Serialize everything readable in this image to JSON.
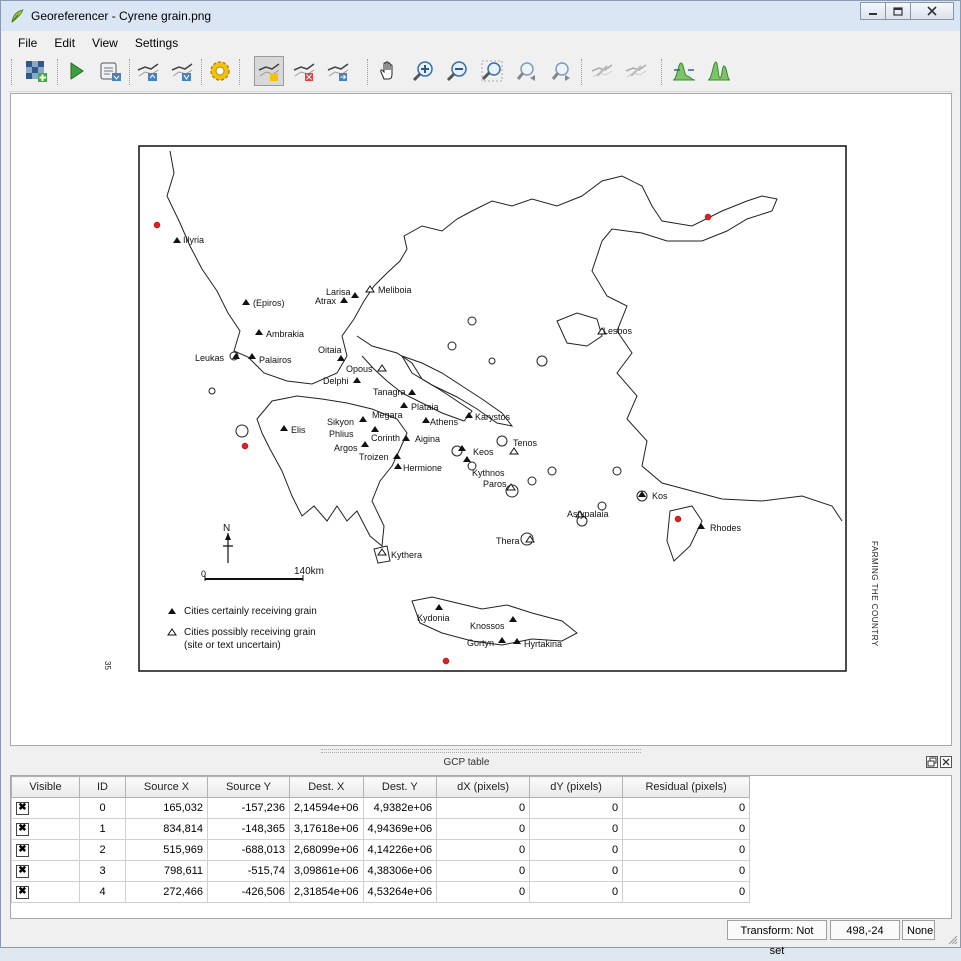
{
  "window": {
    "title": "Georeferencer - Cyrene grain.png",
    "controls": [
      "minimize",
      "maximize",
      "close"
    ]
  },
  "menu": [
    "File",
    "Edit",
    "View",
    "Settings"
  ],
  "toolbar": {
    "icons": [
      "open-raster-icon",
      "start-georeferencing-icon",
      "generate-gdal-script-icon",
      "load-gcp-points-icon",
      "save-gcp-points-icon",
      "transformation-settings-icon",
      "add-point-icon",
      "delete-point-icon",
      "move-gcp-point-icon",
      "pan-icon",
      "zoom-in-icon",
      "zoom-out-icon",
      "zoom-to-layer-icon",
      "zoom-last-icon",
      "zoom-next-icon",
      "link-georeferencer-to-qgis-icon",
      "link-qgis-to-georeferencer-icon",
      "full-histogram-stretch-icon",
      "local-histogram-stretch-icon"
    ]
  },
  "map": {
    "side_text": "FARMING THE COUNTRY",
    "page_number": "35",
    "scale_label": "140km",
    "scale_zero": "0",
    "north_label": "N",
    "legend": {
      "certain": "Cities certainly receiving grain",
      "possible_1": "Cities possibly receiving grain",
      "possible_2": "(site or text uncertain)"
    },
    "labels": {
      "illyria": "Illyria",
      "epiros": "(Epiros)",
      "ambrakia": "Ambrakia",
      "leukas": "Leukas",
      "palairos": "Palairos",
      "larisa": "Larisa",
      "atrax": "Atrax",
      "meliboia": "Meliboia",
      "oitaia": "Oitaia",
      "opous": "Opous",
      "delphi": "Delphi",
      "tanagra": "Tanagra",
      "plataia": "Plataia",
      "megara": "Megara",
      "athens": "Athens",
      "karystos": "Karystos",
      "sikyon": "Sikyon",
      "phlius": "Phlius",
      "corinth": "Corinth",
      "aigina": "Aigina",
      "argos": "Argos",
      "troizen": "Troizen",
      "hermione": "Hermione",
      "elis": "Elis",
      "keos": "Keos",
      "kythnos": "Kythnos",
      "tenos": "Tenos",
      "paros": "Paros",
      "lesbos": "Lesbos",
      "kos": "Kos",
      "rhodes": "Rhodes",
      "astypalaia": "Astypalaia",
      "thera": "Thera",
      "kythera": "Kythera",
      "kydonia": "Kydonia",
      "knossos": "Knossos",
      "gortyn": "Gortyn",
      "hyrtakina": "Hyrtakina"
    }
  },
  "gcp": {
    "title": "GCP table",
    "columns": [
      "Visible",
      "ID",
      "Source X",
      "Source Y",
      "Dest. X",
      "Dest. Y",
      "dX (pixels)",
      "dY (pixels)",
      "Residual (pixels)"
    ],
    "rows": [
      {
        "visible": true,
        "id": "0",
        "sx": "165,032",
        "sy": "-157,236",
        "dx": "2,14594e+06",
        "dy": "4,9382e+06",
        "ex": "0",
        "ey": "0",
        "res": "0"
      },
      {
        "visible": true,
        "id": "1",
        "sx": "834,814",
        "sy": "-148,365",
        "dx": "3,17618e+06",
        "dy": "4,94369e+06",
        "ex": "0",
        "ey": "0",
        "res": "0"
      },
      {
        "visible": true,
        "id": "2",
        "sx": "515,969",
        "sy": "-688,013",
        "dx": "2,68099e+06",
        "dy": "4,14226e+06",
        "ex": "0",
        "ey": "0",
        "res": "0"
      },
      {
        "visible": true,
        "id": "3",
        "sx": "798,611",
        "sy": "-515,74",
        "dx": "3,09861e+06",
        "dy": "4,38306e+06",
        "ex": "0",
        "ey": "0",
        "res": "0"
      },
      {
        "visible": true,
        "id": "4",
        "sx": "272,466",
        "sy": "-426,506",
        "dx": "2,31854e+06",
        "dy": "4,53264e+06",
        "ex": "0",
        "ey": "0",
        "res": "0"
      }
    ]
  },
  "status": {
    "transform": "Transform: Not set",
    "coords": "498,-24",
    "crs": "None"
  }
}
